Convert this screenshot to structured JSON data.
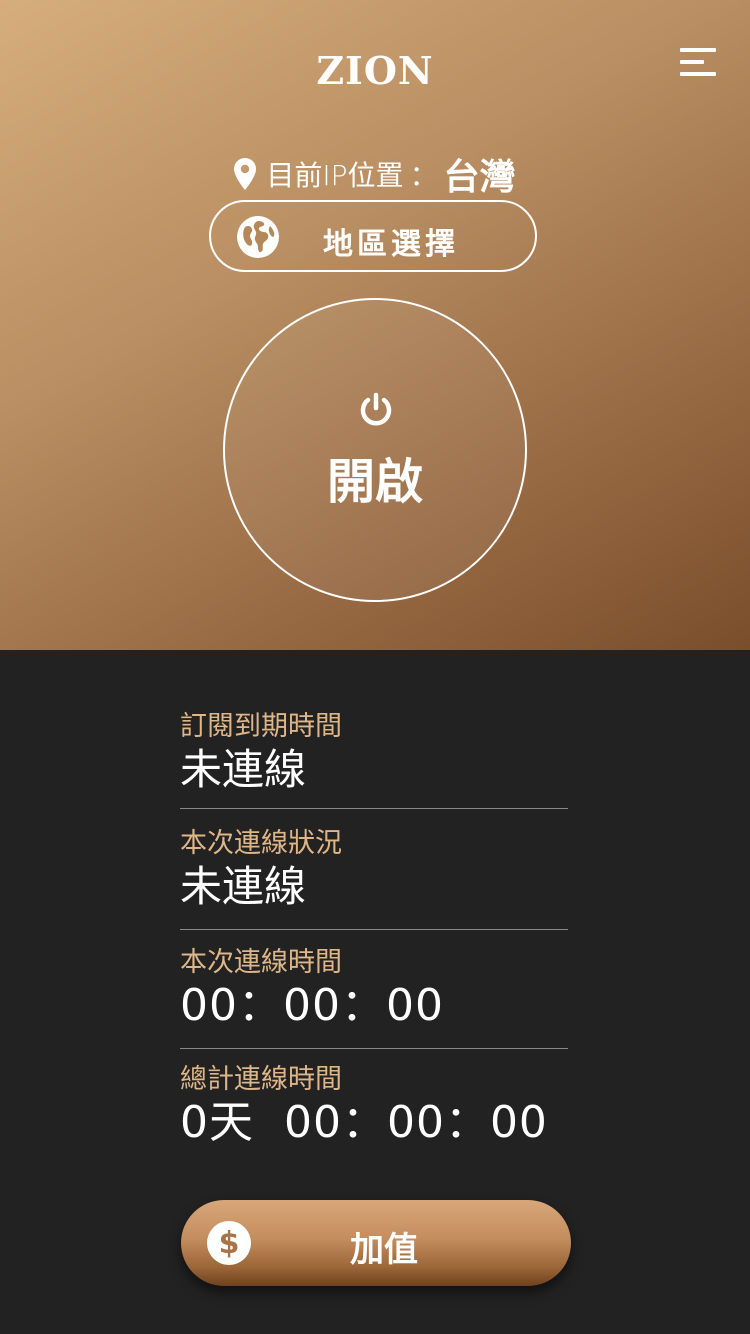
{
  "header": {
    "brand": "ZION",
    "menu_icon": "menu-icon"
  },
  "location": {
    "label": "目前IP位置",
    "colon": "：",
    "value": "台灣",
    "icon": "location-pin-icon"
  },
  "region_button": {
    "label": "地區選擇",
    "icon": "globe-icon"
  },
  "power_button": {
    "label": "開啟",
    "icon": "power-icon"
  },
  "info": {
    "items": [
      {
        "caption": "訂閱到期時間",
        "value": "未連線"
      },
      {
        "caption": "本次連線狀況",
        "value": "未連線"
      },
      {
        "caption": "本次連線時間",
        "value": "00：00：00"
      },
      {
        "caption": "總計連線時間",
        "value": "0天  00：00：00"
      }
    ]
  },
  "topup_button": {
    "label": "加值",
    "icon": "dollar-coin-icon"
  },
  "colors": {
    "accent_gold": "#dfb688",
    "dark_bg": "#222222",
    "hero_light": "#d6ad7c",
    "hero_dark": "#7a4e2b"
  }
}
